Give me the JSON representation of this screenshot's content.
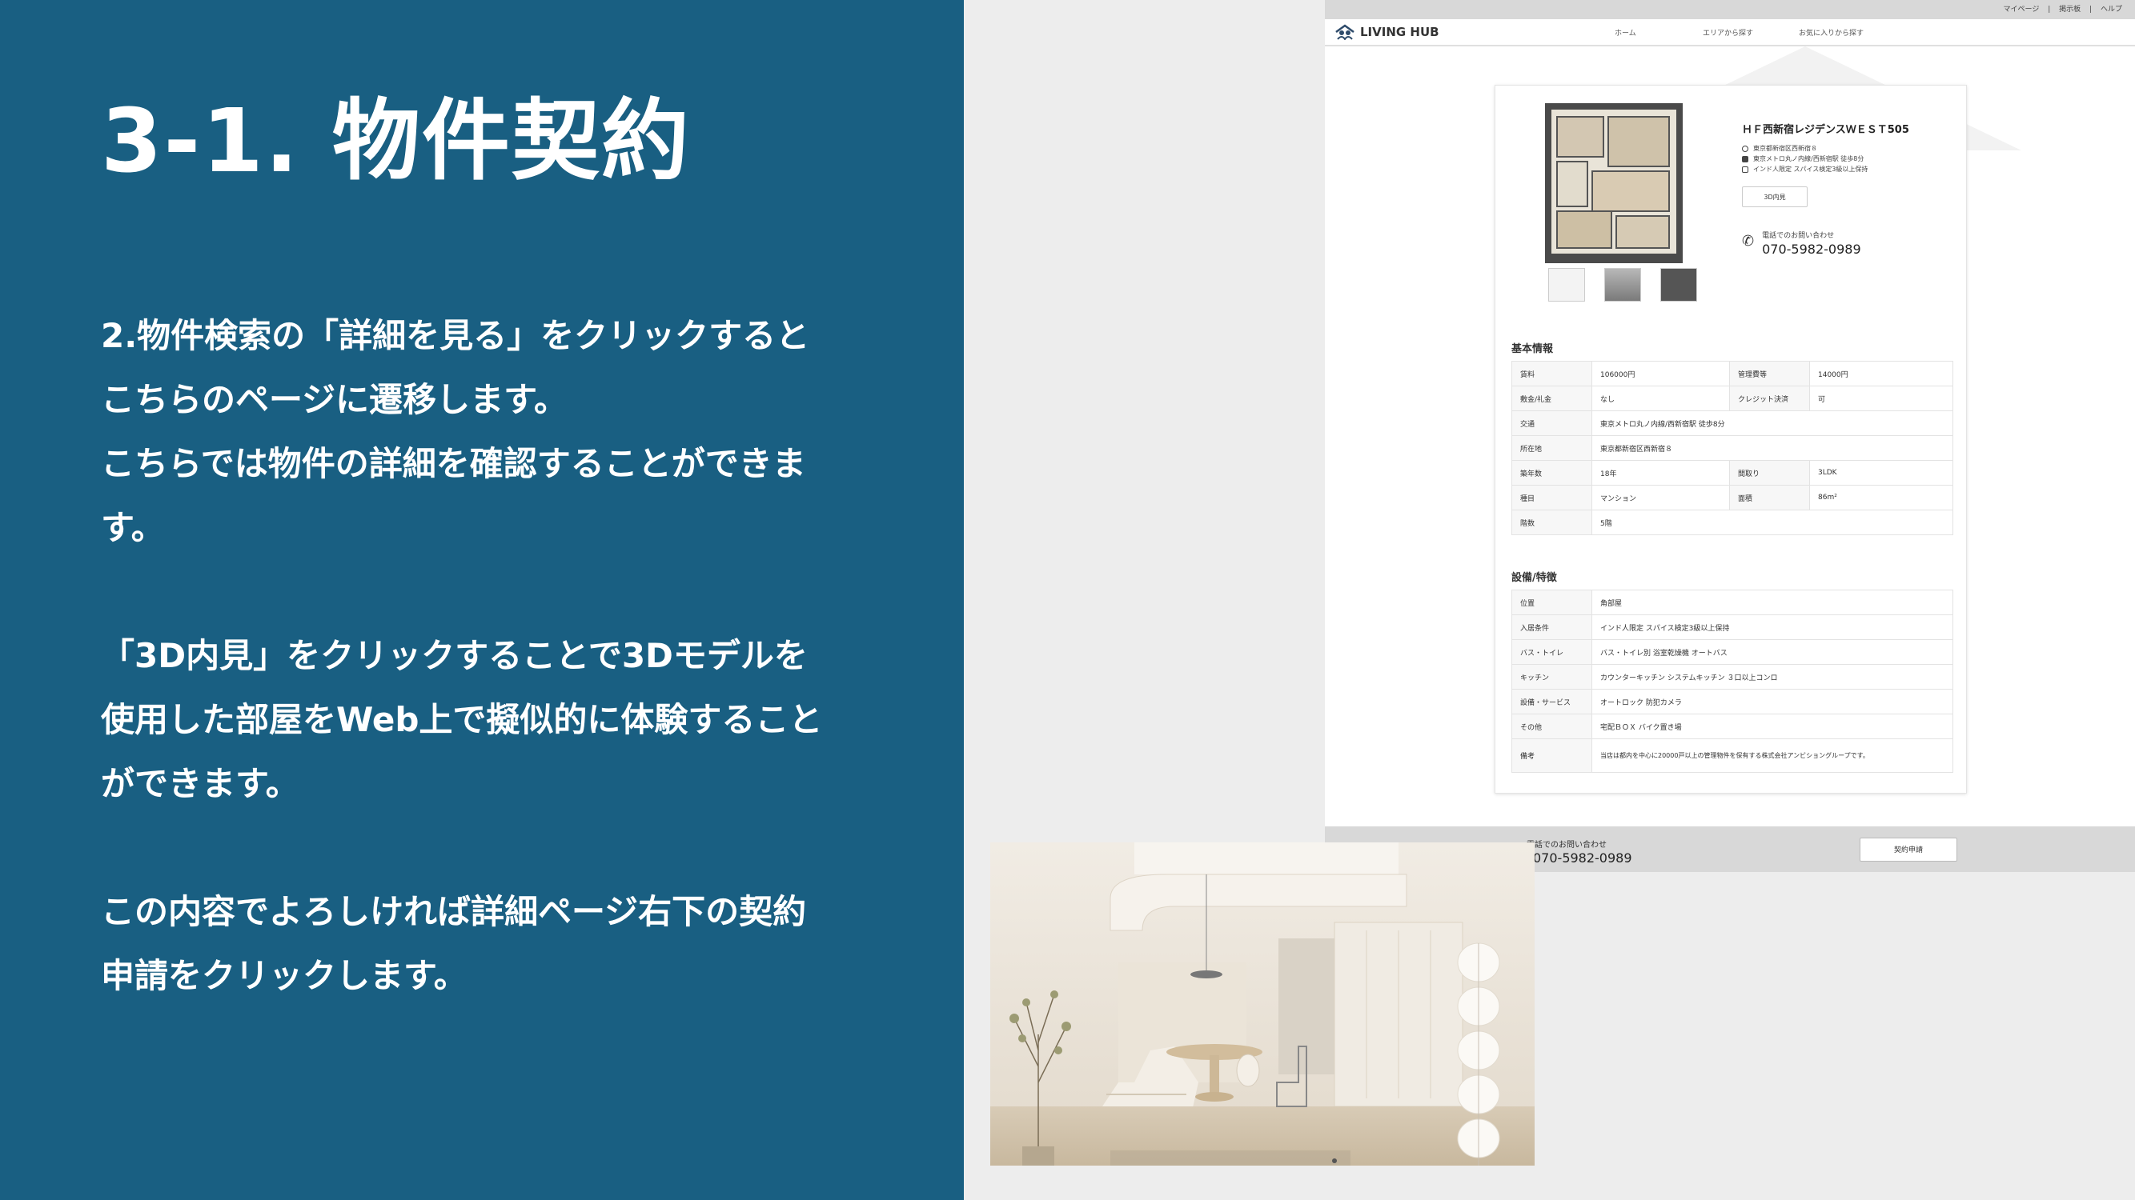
{
  "slide": {
    "title": "3-1. 物件契約",
    "paragraphs": [
      "2.物件検索の「詳細を見る」をクリックすると",
      "こちらのページに遷移します。",
      "こちらでは物件の詳細を確認することができま",
      "す。",
      "",
      "「3D内見」をクリックすることで3Dモデルを",
      "使用した部屋をWeb上で擬似的に体験すること",
      "ができます。",
      "",
      "この内容でよろしければ詳細ページ右下の契約",
      "申請をクリックします。"
    ]
  },
  "screenshot": {
    "util_links": [
      "マイページ",
      "掲示板",
      "ヘルプ"
    ],
    "logo": "LIVING HUB",
    "nav": [
      "ホーム",
      "エリアから探す",
      "お気に入りから探す"
    ],
    "property": {
      "name": "ＨＦ西新宿レジデンスＷＥＳＴ505",
      "address": "東京都新宿区西新宿８",
      "access": "東京メトロ丸ノ内線/西新宿駅 徒歩8分",
      "condition": "インド人限定 スパイス検定3級以上保持",
      "btn_3d": "3D内見",
      "phone_label": "電話でのお問い合わせ",
      "phone": "070-5982-0989"
    },
    "basic_title": "基本情報",
    "basic_rows": [
      [
        "賃料",
        "106000円",
        "管理費等",
        "14000円"
      ],
      [
        "敷金/礼金",
        "なし",
        "クレジット決済",
        "可"
      ],
      [
        "交通",
        "東京メトロ丸ノ内線/西新宿駅 徒歩8分"
      ],
      [
        "所在地",
        "東京都新宿区西新宿８"
      ],
      [
        "築年数",
        "18年",
        "間取り",
        "3LDK"
      ],
      [
        "種目",
        "マンション",
        "面積",
        "86m²"
      ],
      [
        "階数",
        "5階"
      ]
    ],
    "feature_title": "設備/特徴",
    "feature_rows": [
      [
        "位置",
        "角部屋"
      ],
      [
        "入居条件",
        "インド人限定 スパイス検定3級以上保持"
      ],
      [
        "バス・トイレ",
        "バス・トイレ別 浴室乾燥機 オートバス"
      ],
      [
        "キッチン",
        "カウンターキッチン システムキッチン ３口以上コンロ"
      ],
      [
        "設備・サービス",
        "オートロック 防犯カメラ"
      ],
      [
        "その他",
        "宅配ＢＯＸ バイク置き場"
      ],
      [
        "備考",
        "当店は都内を中心に20000戸以上の管理物件を保有する株式会社アンビショングループです。"
      ]
    ],
    "footer": {
      "label": "電話でのお問い合わせ",
      "phone": "070-5982-0989",
      "apply_button": "契約申請"
    }
  },
  "colors": {
    "panel_bg": "#195f82",
    "panel_text": "#ffffff",
    "page_bg": "#ededed"
  }
}
